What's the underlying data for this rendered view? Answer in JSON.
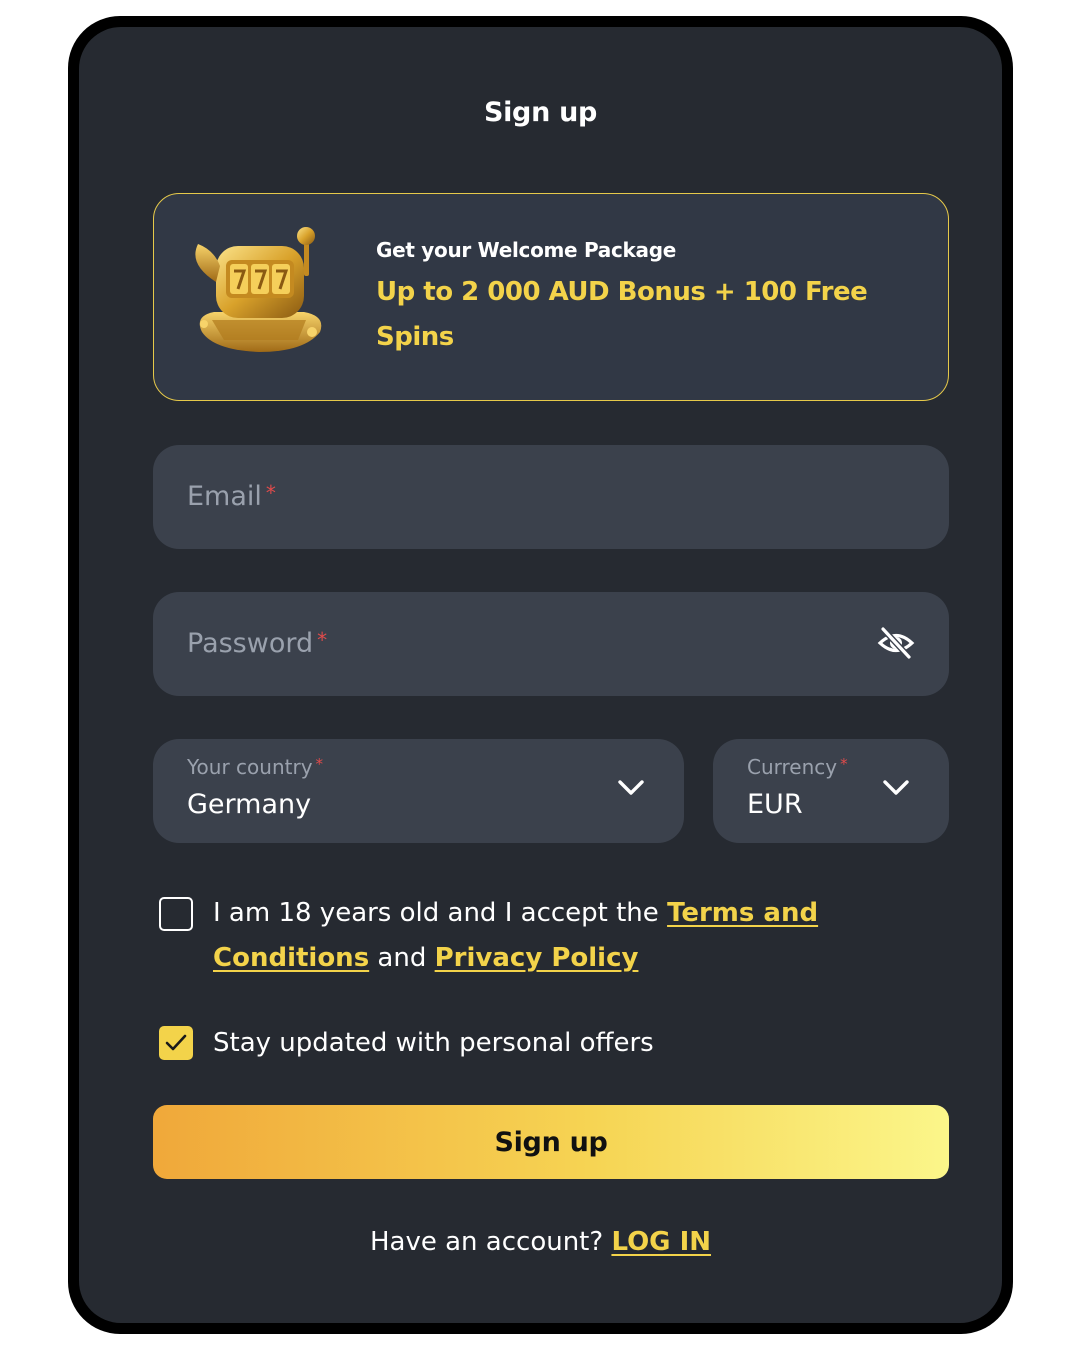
{
  "header": {
    "title": "Sign up"
  },
  "promo": {
    "kicker": "Get your Welcome Package",
    "offer": "Up to 2 000 AUD Bonus + 100 Free Spins",
    "art_icon": "slot-machine-icon"
  },
  "form": {
    "email": {
      "label": "Email",
      "required_mark": "*"
    },
    "password": {
      "label": "Password",
      "required_mark": "*",
      "toggle_icon": "eye-slash-icon"
    },
    "country": {
      "label": "Your country",
      "required_mark": "*",
      "value": "Germany"
    },
    "currency": {
      "label": "Currency",
      "required_mark": "*",
      "value": "EUR"
    }
  },
  "consents": {
    "terms": {
      "checked": false,
      "text_before": "I am 18 years old and I accept the ",
      "terms_link": "Terms and Conditions",
      "text_middle": " and ",
      "privacy_link": "Privacy Policy"
    },
    "offers": {
      "checked": true,
      "text": "Stay updated with personal offers"
    }
  },
  "actions": {
    "signup_label": "Sign up"
  },
  "footer": {
    "account_prompt": "Have an account? ",
    "login_link": "LOG IN"
  },
  "colors": {
    "accent": "#f3d34a",
    "card_bg": "#262a31",
    "field_bg": "#3b414c",
    "required": "#e04b4b"
  }
}
